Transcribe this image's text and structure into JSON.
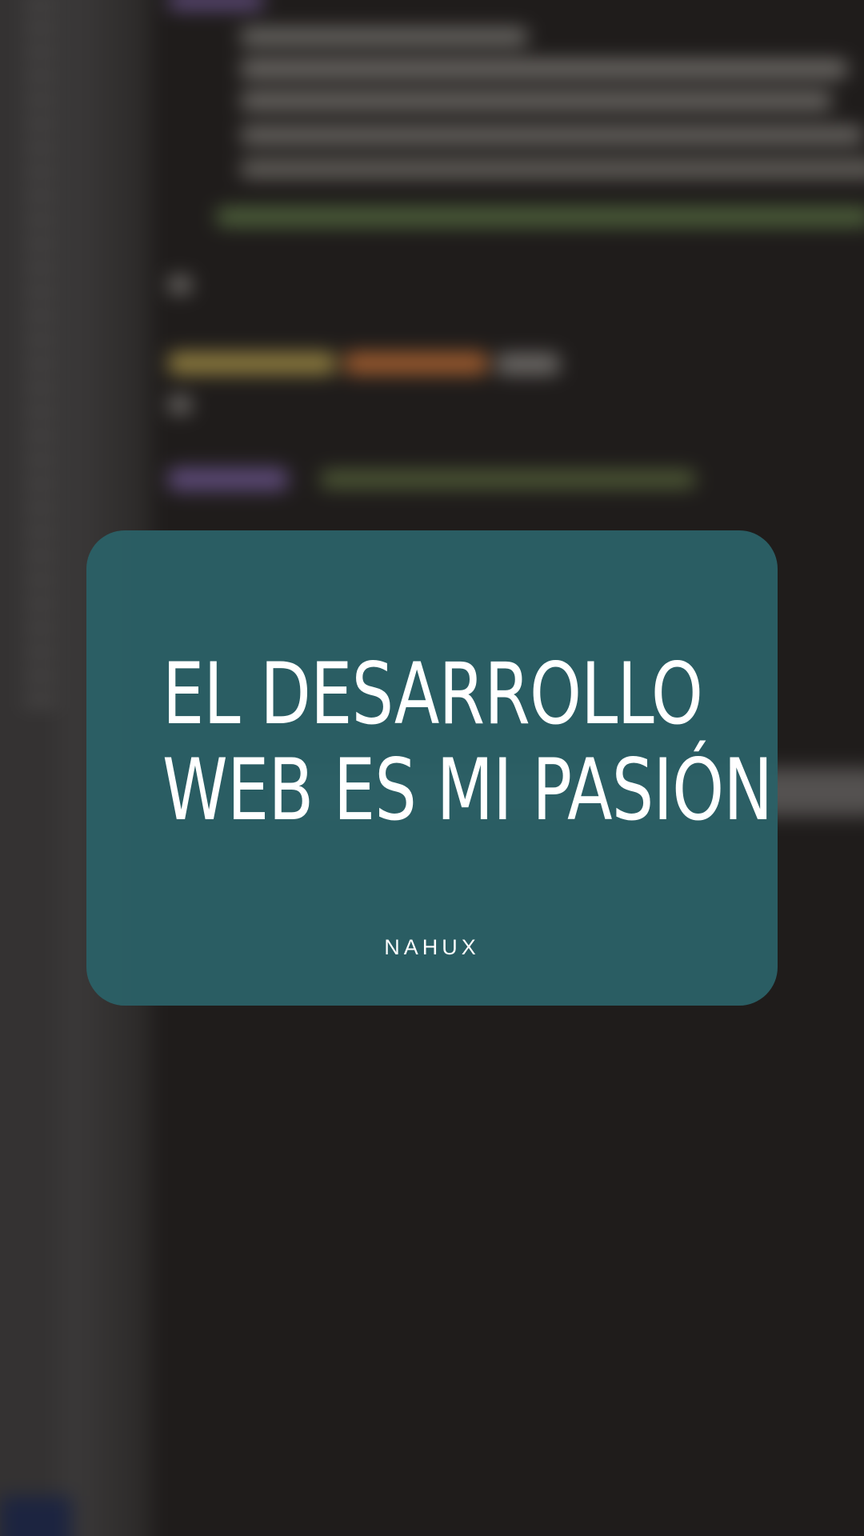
{
  "card": {
    "title_line1": "EL DESARROLLO",
    "title_line2": "WEB ES MI PASIÓN",
    "author": "NAHUX"
  },
  "colors": {
    "card_background": "#2b6066",
    "text": "#ffffff",
    "page_background": "#1f1c1b"
  }
}
